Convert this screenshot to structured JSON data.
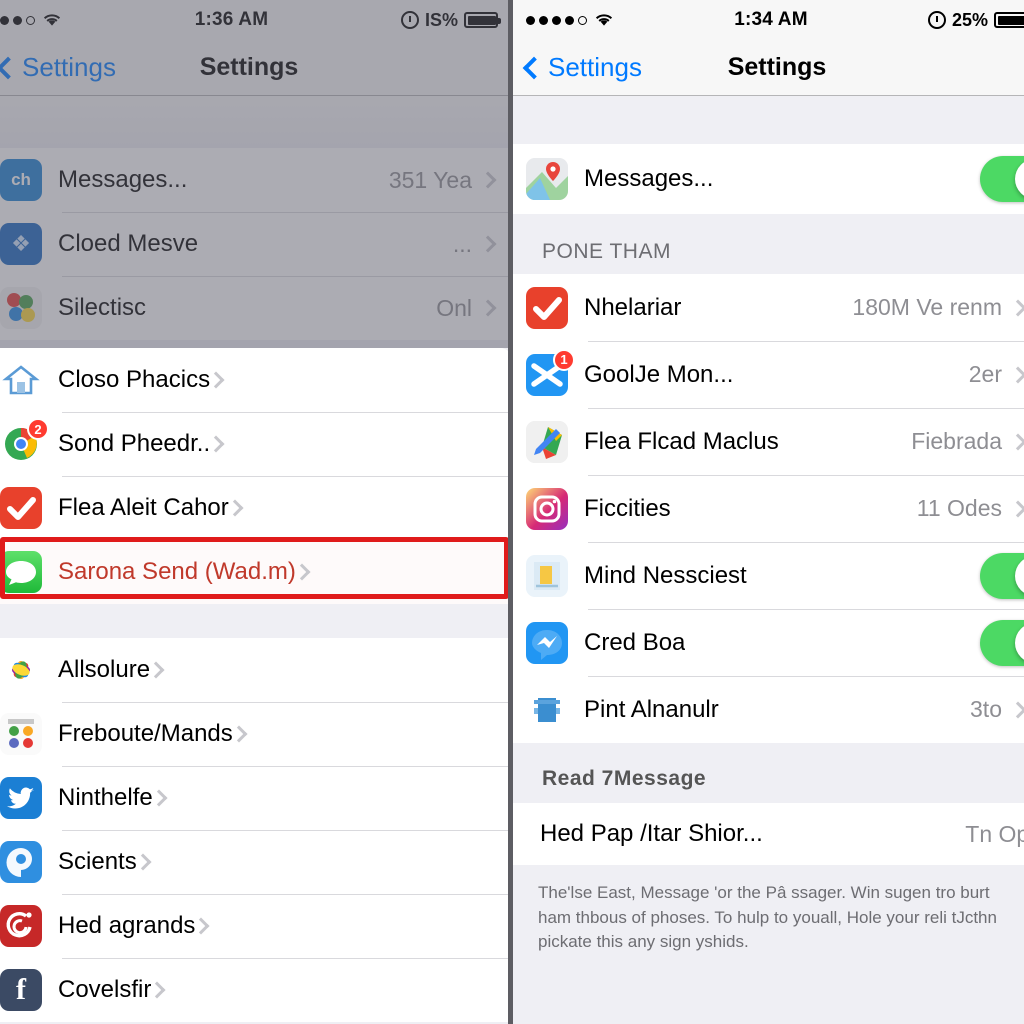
{
  "left_phone": {
    "status": {
      "time": "1:36 AM",
      "battery": "IS%",
      "signal_dots": 3,
      "signal_filled": 2,
      "wifi": "wifi-icon",
      "alarm": "alarm-icon"
    },
    "nav": {
      "back_label": "Settings",
      "title": "Settings"
    },
    "group_top": [
      {
        "label": "Messages...",
        "value": "351 Yea",
        "icon": "watch-app-icon"
      },
      {
        "label": "Cloed Mesve",
        "value": "...",
        "icon": "vpn-app-icon"
      },
      {
        "label": "Silectisc",
        "value": "Onl",
        "icon": "photos-balloons-icon"
      }
    ],
    "group_mid": [
      {
        "label": "Closo Phacics",
        "value": "",
        "icon": "home-app-icon"
      },
      {
        "label": "Sond Pheedr..",
        "value": "",
        "icon": "chrome-app-icon",
        "badge": "2"
      },
      {
        "label": "Flea Aleit Cahor",
        "value": "",
        "icon": "todo-check-icon"
      },
      {
        "label": "Sarona Send (Wad.m)",
        "value": "",
        "icon": "messages-app-icon",
        "highlighted": true
      }
    ],
    "group_bottom": [
      {
        "label": "Allsolure",
        "value": "",
        "icon": "photos-app-icon"
      },
      {
        "label": "Freboute/Mands",
        "value": "",
        "icon": "reminders-app-icon"
      },
      {
        "label": "Ninthelfe",
        "value": "",
        "icon": "twitter-app-icon"
      },
      {
        "label": "Scients",
        "value": "",
        "icon": "location-app-icon"
      },
      {
        "label": "Hed agrands",
        "value": "",
        "icon": "music-swirl-icon"
      },
      {
        "label": "Covelsfir",
        "value": "",
        "icon": "facebook-app-icon"
      }
    ]
  },
  "right_phone": {
    "status": {
      "time": "1:34 AM",
      "battery": "25%",
      "signal_dots": 5,
      "signal_filled": 4,
      "wifi": "wifi-icon",
      "alarm": "alarm-icon"
    },
    "nav": {
      "back_label": "Settings",
      "title": "Settings"
    },
    "group_top": [
      {
        "label": "Messages...",
        "icon": "maps-app-icon",
        "toggle": true
      }
    ],
    "section_1_header": "PONE THAM",
    "group_mid": [
      {
        "label": "Nhelariar",
        "value": "180M Ve renm",
        "icon": "todo-check-icon"
      },
      {
        "label": "GoolJe Mon...",
        "value": "2er",
        "icon": "mail-x-icon",
        "badge": "1"
      },
      {
        "label": "Flea Flcad Maclus",
        "value": "Fiebrada",
        "icon": "maps-pencil-icon"
      },
      {
        "label": "Ficcities",
        "value": "11 Odes",
        "icon": "instagram-app-icon"
      },
      {
        "label": "Mind Nessciest",
        "value": "",
        "icon": "notes-app-icon",
        "toggle": true
      },
      {
        "label": "Cred Boa",
        "value": "",
        "icon": "messenger-app-icon",
        "toggle": true
      },
      {
        "label": "Pint Alnanulr",
        "value": "3to",
        "icon": "printer-app-icon"
      }
    ],
    "section_2_header": "Read 7Message",
    "group_bottom": [
      {
        "label": "Hed Pap /Itar Shior...",
        "value": "Tn Ope",
        "icon": ""
      }
    ],
    "footnote": "The'lse East, Message 'or the Pâ ssager. Win sugen tro burt ham thbous of phoses.  To hulp to youall, Hole your reli tJcth​n pickate this any sign yshids."
  },
  "colors": {
    "accent_blue": "#007aff",
    "toggle_green": "#4cd964",
    "highlight_red": "#e01b1b",
    "highlight_text_red": "#c0392b",
    "list_bg": "#efeff4"
  }
}
